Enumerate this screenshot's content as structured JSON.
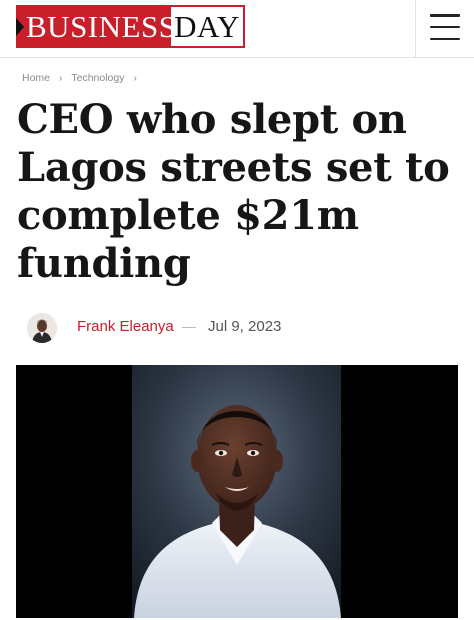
{
  "header": {
    "logo_left": "BUSINESS",
    "logo_right": "DAY",
    "brand_color": "#c81f2a",
    "menu_icon": "hamburger-menu-icon"
  },
  "breadcrumb": {
    "items": [
      "Home",
      "Technology"
    ],
    "separator": "›"
  },
  "article": {
    "headline": "CEO who slept on Lagos streets set to complete $21m funding",
    "author": "Frank Eleanya",
    "separator": "—",
    "date": "Jul 9, 2023"
  }
}
